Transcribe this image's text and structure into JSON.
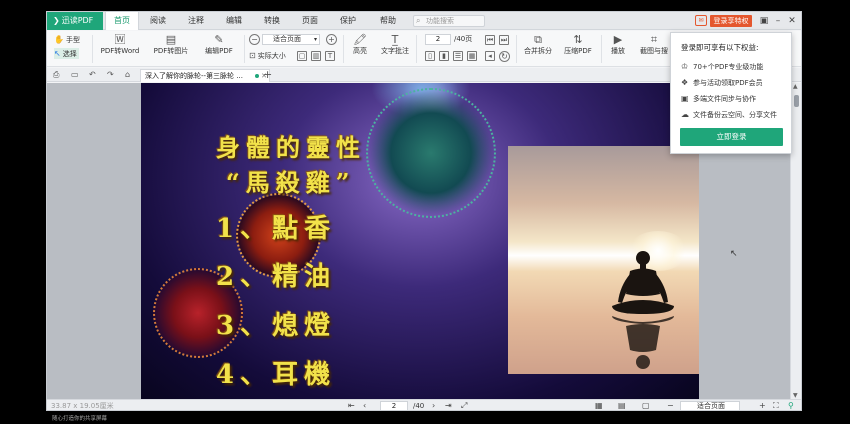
{
  "app": {
    "logo": "迅读PDF",
    "menu": [
      "首页",
      "阅读",
      "注释",
      "编辑",
      "转换",
      "页面",
      "保护",
      "帮助"
    ],
    "active_menu": "首页",
    "search_placeholder": "功能搜索",
    "vip_button": "登录享特权"
  },
  "toolbar": {
    "hand_tool": "手型",
    "select_tool": "选择",
    "pdf_to_word": "PDF转Word",
    "pdf_to_image": "PDF转图片",
    "edit_pdf": "编辑PDF",
    "zoom_value": "适合页面",
    "actual_size": "实际大小",
    "highlight": "高亮",
    "text_comment": "文字批注",
    "page_current": "2",
    "page_total": "/40页",
    "merge_split": "合并拆分",
    "compress_pdf": "压缩PDF",
    "play": "播放",
    "screenshot_search": "截图与搜"
  },
  "tabs": {
    "doc_title": "深入了解你的脉轮--第三脉轮 ..."
  },
  "slide": {
    "line1": "身體的靈性",
    "line2": "“馬殺雞”",
    "item1": "1、點香",
    "item2": "2、精油",
    "item3": "3、熄燈",
    "item4": "4、耳機"
  },
  "popup": {
    "title": "登录即可享有以下权益:",
    "benefits": [
      {
        "icon": "crown-icon",
        "text": "70+个PDF专业级功能"
      },
      {
        "icon": "gift-icon",
        "text": "参与活动领取PDF会员"
      },
      {
        "icon": "sync-icon",
        "text": "多端文件同步与协作"
      },
      {
        "icon": "cloud-icon",
        "text": "文件备份云空间、分享文件"
      }
    ],
    "login_button": "立即登录"
  },
  "status": {
    "dimensions": "33.87 x 19.05厘米",
    "page_current": "2",
    "page_total": "/40",
    "zoom_value": "适合页面"
  },
  "caption": "随心打造你的共享屏幕",
  "colors": {
    "brand": "#1fa67a",
    "vip": "#e4572e",
    "slide_text": "#f2e24a"
  }
}
